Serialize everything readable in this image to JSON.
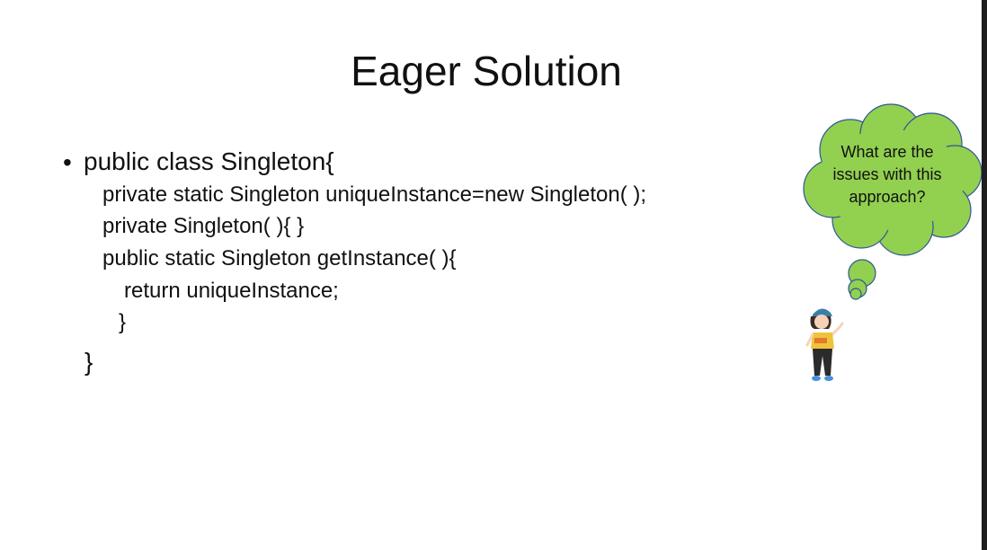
{
  "slide": {
    "title": "Eager Solution",
    "bullet": "•",
    "code_lines": [
      "public class Singleton{",
      "private static Singleton uniqueInstance=new Singleton( );",
      "private Singleton( ){ }",
      "public static Singleton getInstance( ){",
      "return uniqueInstance;",
      "}",
      "}"
    ],
    "callout": {
      "text": "What are the issues with this approach?",
      "shape": "thought-cloud",
      "fill_color": "#92d050",
      "stroke_color": "#2f5597"
    },
    "illustration": "girl-cartoon-icon"
  }
}
